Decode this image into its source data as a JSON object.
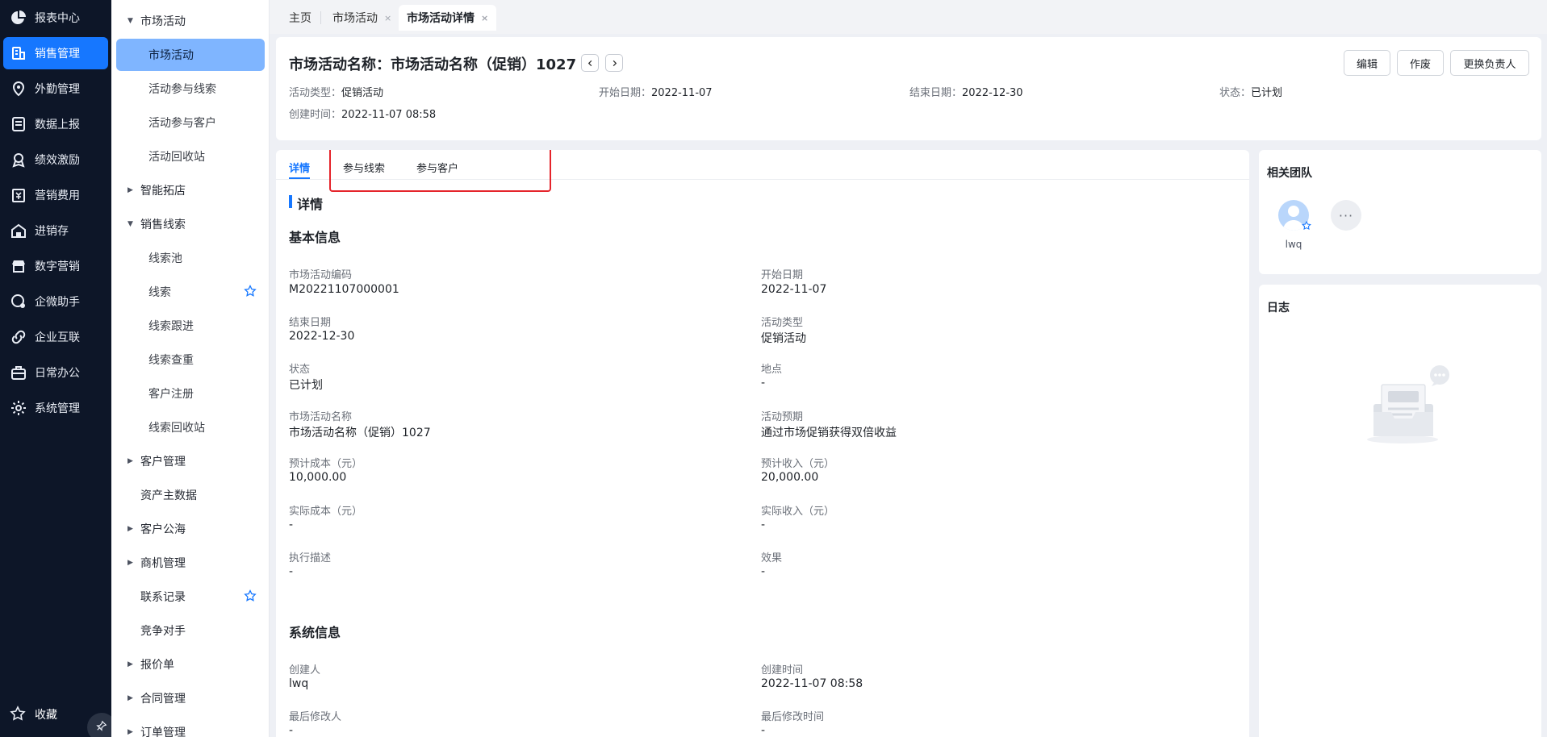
{
  "rail": {
    "items": [
      {
        "label": "报表中心",
        "icon": "pie-chart-icon"
      },
      {
        "label": "销售管理",
        "icon": "sales-icon",
        "active": true
      },
      {
        "label": "外勤管理",
        "icon": "location-pin-icon"
      },
      {
        "label": "数据上报",
        "icon": "report-upload-icon"
      },
      {
        "label": "绩效激励",
        "icon": "medal-icon"
      },
      {
        "label": "营销费用",
        "icon": "expense-icon"
      },
      {
        "label": "进销存",
        "icon": "warehouse-icon"
      },
      {
        "label": "数字营销",
        "icon": "store-icon"
      },
      {
        "label": "企微助手",
        "icon": "wecom-icon"
      },
      {
        "label": "企业互联",
        "icon": "link-icon"
      },
      {
        "label": "日常办公",
        "icon": "briefcase-icon"
      },
      {
        "label": "系统管理",
        "icon": "gear-icon"
      }
    ],
    "favorites": "收藏"
  },
  "subnav": {
    "items": [
      {
        "label": "市场活动",
        "type": "group-open"
      },
      {
        "label": "市场活动",
        "type": "child",
        "active": true
      },
      {
        "label": "活动参与线索",
        "type": "child"
      },
      {
        "label": "活动参与客户",
        "type": "child"
      },
      {
        "label": "活动回收站",
        "type": "child"
      },
      {
        "label": "智能拓店",
        "type": "group-closed"
      },
      {
        "label": "销售线索",
        "type": "group-open"
      },
      {
        "label": "线索池",
        "type": "child"
      },
      {
        "label": "线索",
        "type": "child",
        "star": true
      },
      {
        "label": "线索跟进",
        "type": "child"
      },
      {
        "label": "线索查重",
        "type": "child"
      },
      {
        "label": "客户注册",
        "type": "child"
      },
      {
        "label": "线索回收站",
        "type": "child"
      },
      {
        "label": "客户管理",
        "type": "group-closed"
      },
      {
        "label": "资产主数据",
        "type": "group-plain"
      },
      {
        "label": "客户公海",
        "type": "group-closed"
      },
      {
        "label": "商机管理",
        "type": "group-closed"
      },
      {
        "label": "联系记录",
        "type": "group-plain",
        "star": true
      },
      {
        "label": "竞争对手",
        "type": "group-plain"
      },
      {
        "label": "报价单",
        "type": "group-closed"
      },
      {
        "label": "合同管理",
        "type": "group-closed"
      },
      {
        "label": "订单管理",
        "type": "group-closed"
      }
    ]
  },
  "topTabs": {
    "home": "主页",
    "tab1": "市场活动",
    "tab2": "市场活动详情",
    "close": "×"
  },
  "header": {
    "title": "市场活动名称：市场活动名称（促销）1027",
    "buttons": {
      "edit": "编辑",
      "void": "作废",
      "changeOwner": "更换负责人"
    },
    "meta": {
      "typeLabel": "活动类型：",
      "typeValue": "促销活动",
      "startLabel": "开始日期：",
      "startValue": "2022-11-07",
      "endLabel": "结束日期：",
      "endValue": "2022-12-30",
      "statusLabel": "状态：",
      "statusValue": "已计划",
      "createdLabel": "创建时间：",
      "createdValue": "2022-11-07 08:58"
    }
  },
  "detail": {
    "tabs": [
      "详情",
      "参与线索",
      "参与客户"
    ],
    "sectionTitle": "详情",
    "basicTitle": "基本信息",
    "systemTitle": "系统信息",
    "fields": [
      {
        "label": "市场活动编码",
        "value": "M20221107000001"
      },
      {
        "label": "开始日期",
        "value": "2022-11-07"
      },
      {
        "label": "结束日期",
        "value": "2022-12-30"
      },
      {
        "label": "活动类型",
        "value": "促销活动"
      },
      {
        "label": "状态",
        "value": "已计划"
      },
      {
        "label": "地点",
        "value": "-"
      },
      {
        "label": "市场活动名称",
        "value": "市场活动名称（促销）1027"
      },
      {
        "label": "活动预期",
        "value": "通过市场促销获得双倍收益"
      },
      {
        "label": "预计成本（元）",
        "value": "10,000.00"
      },
      {
        "label": "预计收入（元）",
        "value": "20,000.00"
      },
      {
        "label": "实际成本（元）",
        "value": "-"
      },
      {
        "label": "实际收入（元）",
        "value": "-"
      },
      {
        "label": "执行描述",
        "value": "-"
      },
      {
        "label": "效果",
        "value": "-"
      }
    ],
    "systemFields": [
      {
        "label": "创建人",
        "value": "lwq"
      },
      {
        "label": "创建时间",
        "value": "2022-11-07 08:58"
      },
      {
        "label": "最后修改人",
        "value": "-"
      },
      {
        "label": "最后修改时间",
        "value": "-"
      }
    ]
  },
  "team": {
    "title": "相关团队",
    "member": "lwq",
    "more": "···"
  },
  "log": {
    "title": "日志"
  },
  "colors": {
    "brand": "#1677ff",
    "rail": "#0d1628",
    "highlight": "#e5242b"
  }
}
